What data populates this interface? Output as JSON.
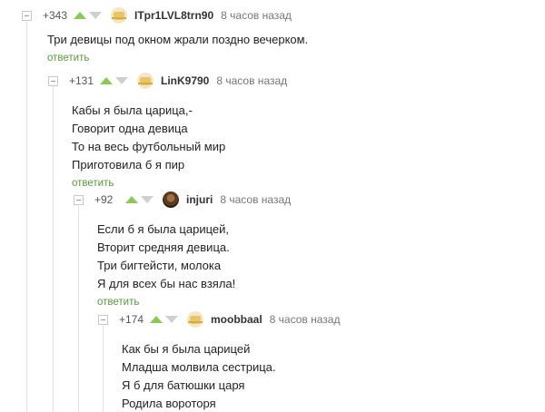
{
  "comments": [
    {
      "rating": "+343",
      "username": "ITpr1LVL8trn90",
      "time": "8 часов назад",
      "lines": [
        "Три девицы под окном жрали поздно вечерком."
      ],
      "reply_label": "ответить",
      "avatar_icon": "default-avatar-icon"
    },
    {
      "rating": "+131",
      "username": "LinK9790",
      "time": "8 часов назад",
      "lines": [
        "Кабы я была царица,-",
        "Говорит одна девица",
        "То на весь футбольный мир",
        "Приготовила б я пир"
      ],
      "reply_label": "ответить",
      "avatar_icon": "default-avatar-icon"
    },
    {
      "rating": "+92",
      "username": "injuri",
      "time": "8 часов назад",
      "lines": [
        "Если б я была царицей,",
        "Вторит средняя девица.",
        "Три бигтейсти, молока",
        "Я для всех бы нас взяла!"
      ],
      "reply_label": "ответить",
      "avatar_icon": "photo-avatar-icon"
    },
    {
      "rating": "+174",
      "username": "moobbaal",
      "time": "8 часов назад",
      "lines": [
        "Как бы я была царицей",
        "Младша молвила сестрица.",
        "Я б для батюшки царя",
        "Родила вороторя"
      ],
      "avatar_icon": "default-avatar-icon"
    }
  ],
  "colors": {
    "upvote": "#8ac858",
    "downvote": "#cfcfcf",
    "reply_link": "#5a9a3c",
    "thread_line": "#e2e2e2"
  }
}
